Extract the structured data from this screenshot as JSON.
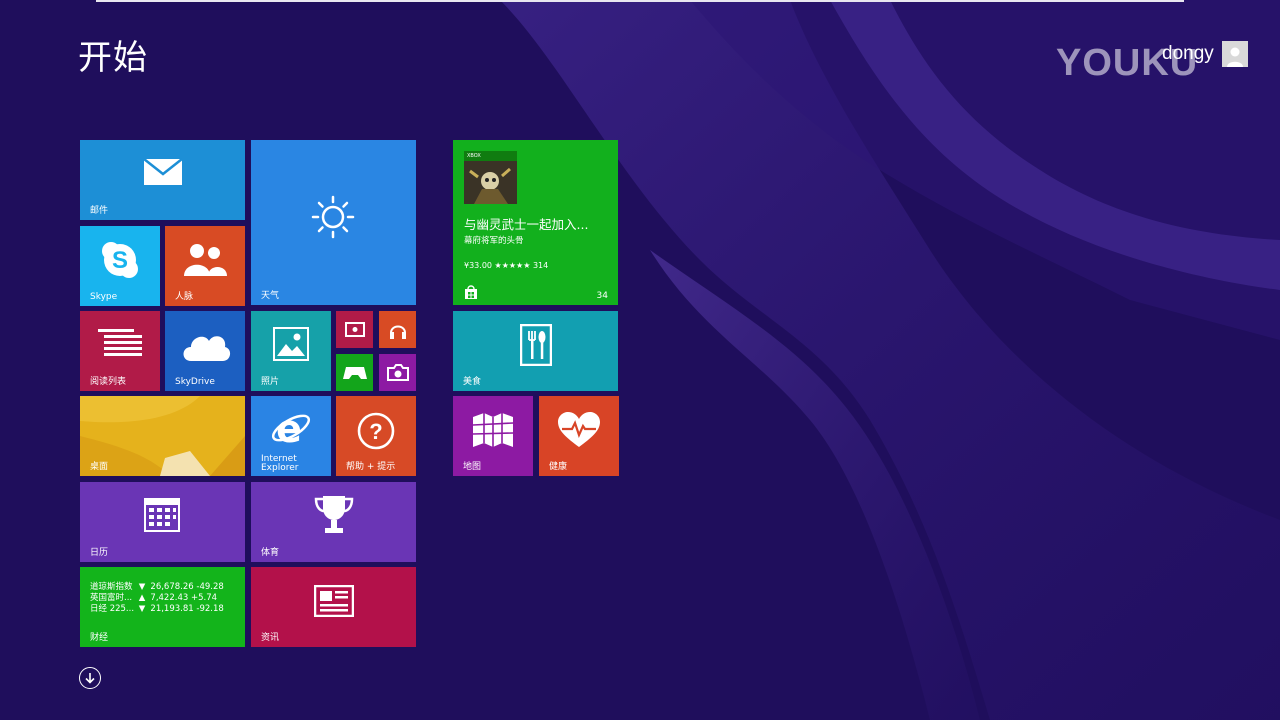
{
  "screen": {
    "title": "开始"
  },
  "watermark": "YOUKU",
  "user": {
    "name": "dongy"
  },
  "tiles": {
    "mail": {
      "label": "邮件"
    },
    "weather": {
      "label": "天气"
    },
    "skype": {
      "label": "Skype"
    },
    "people": {
      "label": "人脉"
    },
    "reading": {
      "label": "阅读列表"
    },
    "skydrive": {
      "label": "SkyDrive"
    },
    "photos": {
      "label": "照片"
    },
    "desktop": {
      "label": "桌面"
    },
    "ie": {
      "label_line1": "Internet",
      "label_line2": "Explorer"
    },
    "help": {
      "label": "帮助 + 提示"
    },
    "calendar": {
      "label": "日历"
    },
    "sports": {
      "label": "体育"
    },
    "finance": {
      "label": "财经",
      "rows": [
        {
          "name": "道琼斯指数",
          "arrow": "▼",
          "value": "26,678.26",
          "change": "-49.28"
        },
        {
          "name": "英国富时...",
          "arrow": "▲",
          "value": "7,422.43",
          "change": "+5.74"
        },
        {
          "name": "日经 225...",
          "arrow": "▼",
          "value": "21,193.81",
          "change": "-92.18"
        }
      ]
    },
    "news": {
      "label": "资讯"
    },
    "store": {
      "badge": "XBOX",
      "title": "与幽灵武士一起加入...",
      "subtitle": "幕府将军的头骨",
      "price": "¥33.00 ★★★★★ 314",
      "count": "34"
    },
    "food": {
      "label": "美食"
    },
    "maps": {
      "label": "地图"
    },
    "health": {
      "label": "健康"
    }
  },
  "colors": {
    "background": "#1f0e5c",
    "mail": "#1d8fd6",
    "weather": "#2a86e3",
    "skype": "#18b4ee",
    "people": "#d84b24",
    "reading": "#b11b48",
    "skydrive": "#1c5fc1",
    "photos": "#16a1a9",
    "desktop": "#e5b21c",
    "ie": "#2a84e4",
    "help": "#d74a26",
    "calendar": "#6a35b5",
    "sports": "#6a35b5",
    "finance": "#13b41b",
    "news": "#b3114a",
    "store": "#12b01d",
    "food": "#129fb1",
    "maps": "#8d1aa3",
    "health": "#d84426"
  }
}
